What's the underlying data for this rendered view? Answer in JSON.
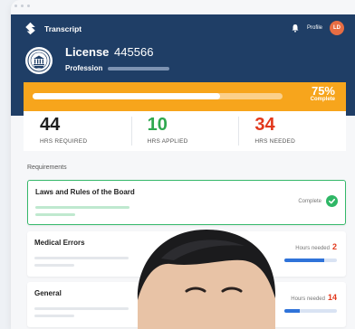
{
  "app": {
    "title": "Transcript",
    "profile_label": "Profile",
    "avatar_initials": "LD"
  },
  "license": {
    "label": "License",
    "number": "445566",
    "profession_label": "Profession"
  },
  "progress": {
    "percent_text": "75%",
    "status": "Complete",
    "fraction": 0.75
  },
  "stats": [
    {
      "value": "44",
      "label": "HRS REQUIRED",
      "color": "#1e1e1e"
    },
    {
      "value": "10",
      "label": "HRS APPLIED",
      "color": "#2fa84f"
    },
    {
      "value": "34",
      "label": "HRS NEEDED",
      "color": "#e2381c"
    }
  ],
  "requirements": {
    "title": "Requirements",
    "items": [
      {
        "name": "Laws and Rules of the Board",
        "status": "Complete"
      },
      {
        "name": "Medical Errors",
        "hours_label": "Hours needed",
        "hours": "2",
        "fraction": 0.75
      },
      {
        "name": "General",
        "hours_label": "Hours needed",
        "hours": "14",
        "fraction": 0.3
      }
    ]
  },
  "colors": {
    "header": "#1f3e66",
    "accent": "#f7a51c",
    "success": "#35b86a",
    "danger": "#e2381c"
  }
}
